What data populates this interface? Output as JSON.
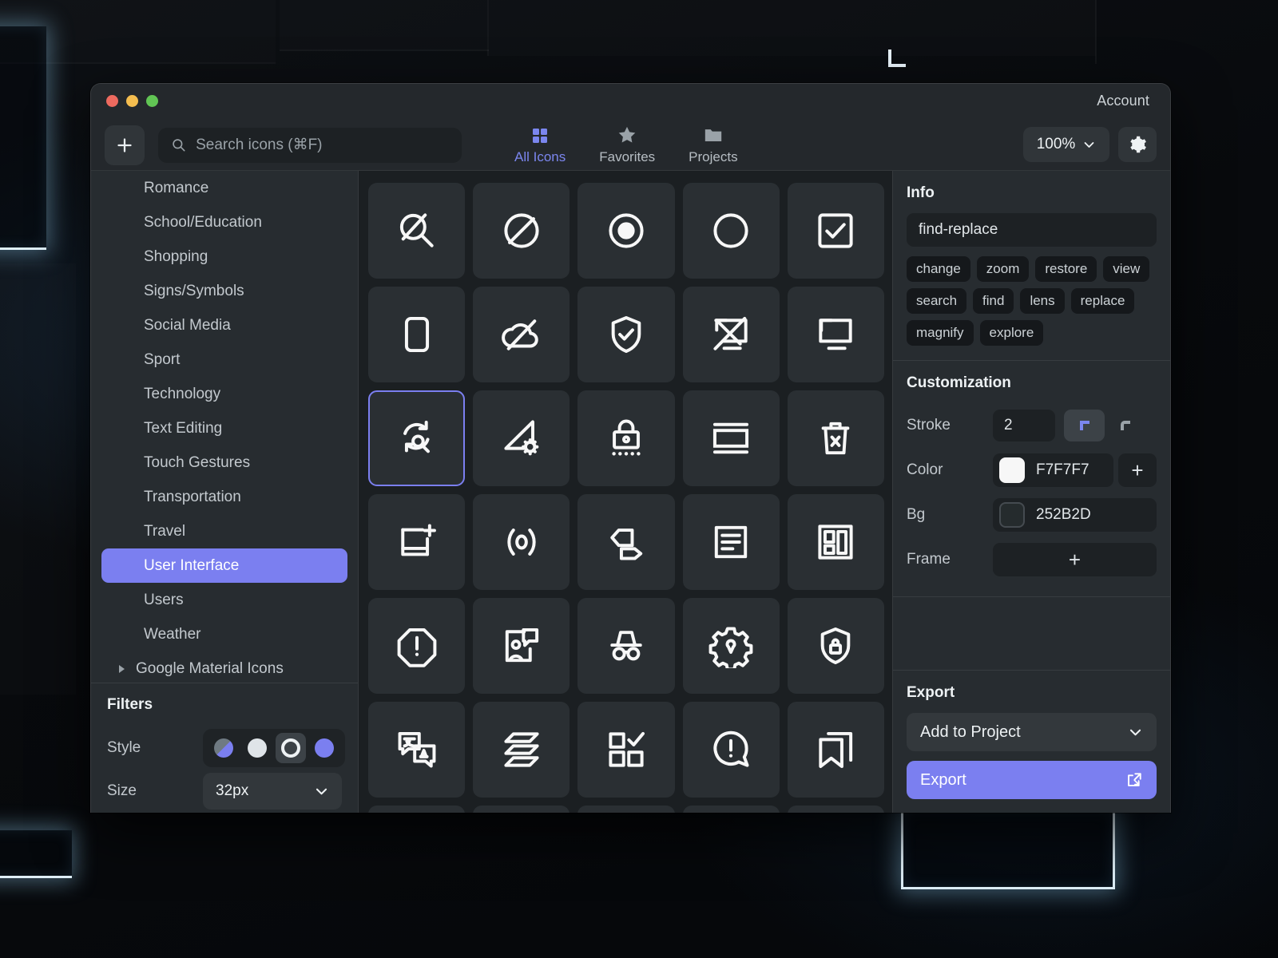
{
  "titlebar": {
    "account_label": "Account"
  },
  "toolbar": {
    "add_label": "+",
    "search": {
      "placeholder": "Search icons (⌘F)",
      "value": ""
    },
    "tabs": [
      {
        "label": "All Icons",
        "icon": "grid-icon",
        "active": true
      },
      {
        "label": "Favorites",
        "icon": "star-icon",
        "active": false
      },
      {
        "label": "Projects",
        "icon": "folder-icon",
        "active": false
      }
    ],
    "zoom_value": "100%",
    "settings_icon": "gear-icon"
  },
  "sidebar": {
    "categories": [
      {
        "label": "Romance",
        "selected": false
      },
      {
        "label": "School/Education",
        "selected": false
      },
      {
        "label": "Shopping",
        "selected": false
      },
      {
        "label": "Signs/Symbols",
        "selected": false
      },
      {
        "label": "Social Media",
        "selected": false
      },
      {
        "label": "Sport",
        "selected": false
      },
      {
        "label": "Technology",
        "selected": false
      },
      {
        "label": "Text Editing",
        "selected": false
      },
      {
        "label": "Touch Gestures",
        "selected": false
      },
      {
        "label": "Transportation",
        "selected": false
      },
      {
        "label": "Travel",
        "selected": false
      },
      {
        "label": "User Interface",
        "selected": true
      },
      {
        "label": "Users",
        "selected": false
      },
      {
        "label": "Weather",
        "selected": false
      }
    ],
    "group_label": "Google Material Icons",
    "filters": {
      "title": "Filters",
      "style_label": "Style",
      "style_options": [
        "duotone",
        "filled",
        "outline",
        "solid"
      ],
      "style_selected": "outline",
      "size_label": "Size",
      "size_value": "32px"
    }
  },
  "grid": {
    "icons": [
      {
        "name": "search-off-icon",
        "selected": false
      },
      {
        "name": "circle-slash-icon",
        "selected": false
      },
      {
        "name": "radio-button-selected-icon",
        "selected": false
      },
      {
        "name": "circle-icon",
        "selected": false
      },
      {
        "name": "checkbox-checked-icon",
        "selected": false
      },
      {
        "name": "rounded-square-icon",
        "selected": false
      },
      {
        "name": "cloud-off-icon",
        "selected": false
      },
      {
        "name": "shield-check-icon",
        "selected": false
      },
      {
        "name": "screen-share-off-icon",
        "selected": false
      },
      {
        "name": "screen-share-icon",
        "selected": false
      },
      {
        "name": "find-replace-icon",
        "selected": true
      },
      {
        "name": "angle-settings-icon",
        "selected": false
      },
      {
        "name": "password-lock-icon",
        "selected": false
      },
      {
        "name": "window-layout-icon",
        "selected": false
      },
      {
        "name": "delete-forever-icon",
        "selected": false
      },
      {
        "name": "add-frame-icon",
        "selected": false
      },
      {
        "name": "sensors-icon",
        "selected": false
      },
      {
        "name": "tags-icon",
        "selected": false
      },
      {
        "name": "article-icon",
        "selected": false
      },
      {
        "name": "dashboard-layout-icon",
        "selected": false
      },
      {
        "name": "octagon-alert-icon",
        "selected": false
      },
      {
        "name": "user-message-icon",
        "selected": false
      },
      {
        "name": "incognito-icon",
        "selected": false
      },
      {
        "name": "gear-location-icon",
        "selected": false
      },
      {
        "name": "shield-lock-icon",
        "selected": false
      },
      {
        "name": "translate-icon",
        "selected": false
      },
      {
        "name": "layers-stack-icon",
        "selected": false
      },
      {
        "name": "select-check-box-icon",
        "selected": false
      },
      {
        "name": "alert-bubble-icon",
        "selected": false
      },
      {
        "name": "bookmarks-icon",
        "selected": false
      }
    ]
  },
  "inspector": {
    "info": {
      "title": "Info",
      "icon_name": "find-replace",
      "tags": [
        "change",
        "zoom",
        "restore",
        "view",
        "search",
        "find",
        "lens",
        "replace",
        "magnify",
        "explore"
      ]
    },
    "customization": {
      "title": "Customization",
      "stroke_label": "Stroke",
      "stroke_value": "2",
      "corner_sharp_selected": true,
      "color_label": "Color",
      "color_value": "F7F7F7",
      "bg_label": "Bg",
      "bg_value": "252B2D",
      "frame_label": "Frame",
      "frame_add": "+",
      "color_add": "+"
    },
    "export": {
      "title": "Export",
      "project_select": "Add to Project",
      "export_button": "Export"
    }
  },
  "colors": {
    "accent": "#7b7ff0",
    "window_bg": "#24282c",
    "grid_bg": "#1b1f22",
    "tile_bg": "#2a2f33",
    "icon_stroke": "#F7F7F7"
  }
}
